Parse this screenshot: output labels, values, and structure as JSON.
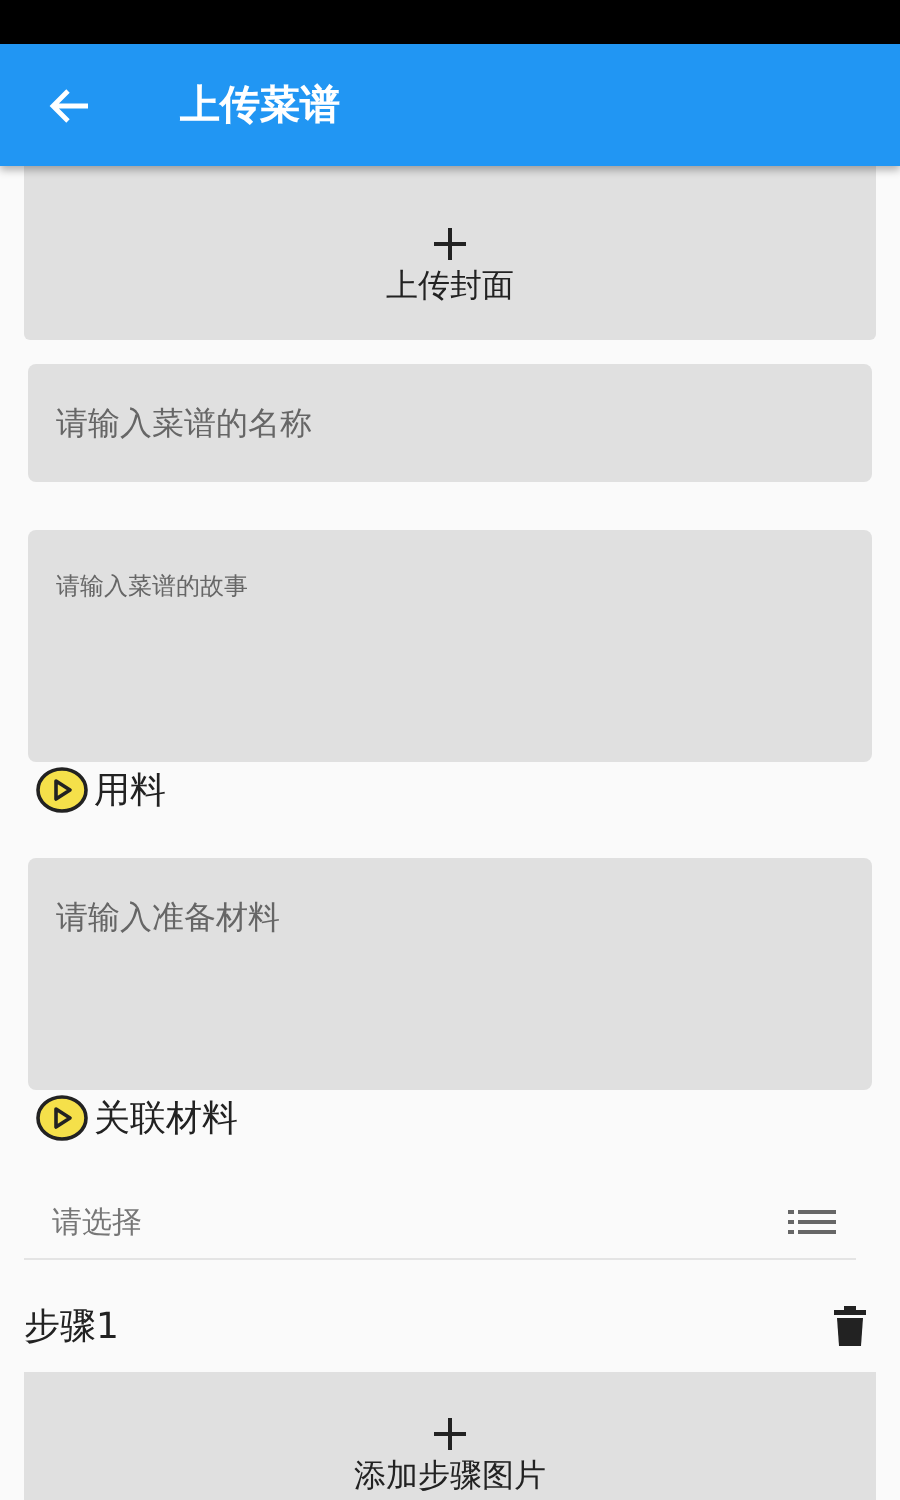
{
  "app_bar": {
    "title": "上传菜谱"
  },
  "cover": {
    "label": "上传封面"
  },
  "name_field": {
    "placeholder": "请输入菜谱的名称"
  },
  "story_field": {
    "placeholder": "请输入菜谱的故事"
  },
  "sections": [
    {
      "heading": "用料",
      "field": {
        "kind": "textarea",
        "placeholder": "请输入准备材料"
      }
    },
    {
      "heading": "关联材料",
      "field": {
        "kind": "select",
        "placeholder": "请选择"
      }
    }
  ],
  "steps": [
    {
      "title": "步骤1",
      "image_label": "添加步骤图片"
    }
  ]
}
